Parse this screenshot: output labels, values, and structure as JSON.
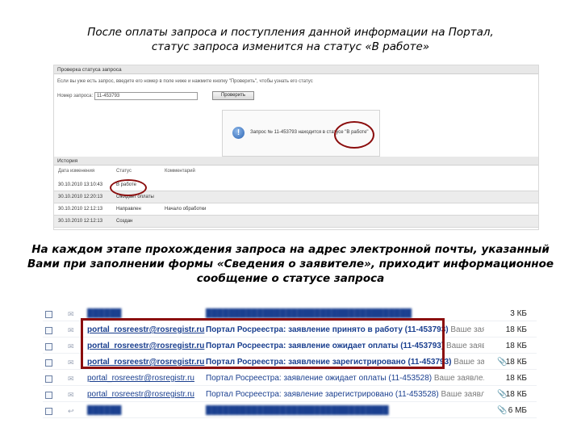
{
  "captions": {
    "top_line1": "После оплаты запроса и поступления данной информации на Портал,",
    "top_line2": "статус запроса изменится на статус «В работе»",
    "bottom_line1": "На каждом этапе прохождения запроса на адрес электронной почты, указанный",
    "bottom_line2": "Вами при заполнении формы «Сведения о заявителе», приходит информационное",
    "bottom_line3": "сообщение о статусе запроса"
  },
  "portal": {
    "panel_title": "Проверка статуса запроса",
    "hint": "Если вы уже есть запрос, введите его номер в поле ниже и нажмите кнопку \"Проверить\", чтобы узнать его статус",
    "request_number_label": "Номер запроса:",
    "request_number_value": "11-453793",
    "check_button": "Проверить",
    "status_message": "Запрос № 11-453793 находится в статусе \"В работе\"",
    "history_title": "История",
    "history_columns": [
      "Дата изменения",
      "Статус",
      "Комментарий"
    ],
    "history_rows": [
      {
        "date": "30.10.2010 13:10:43",
        "status": "В работе",
        "comment": ""
      },
      {
        "date": "30.10.2010 12:20:13",
        "status": "Ожидает оплаты",
        "comment": ""
      },
      {
        "date": "30.10.2010 12:12:13",
        "status": "Направлен",
        "comment": "Начало обработки"
      },
      {
        "date": "30.10.2010 12:12:13",
        "status": "Создан",
        "comment": ""
      }
    ]
  },
  "mail": {
    "rows": [
      {
        "sender": "",
        "subject": "",
        "snippet": "",
        "attachment": false,
        "size": "3 КБ"
      },
      {
        "sender": "portal_rosreestr@rosregistr.ru",
        "subject": "Портал Росреестра: заявление принято в работу (11-453793)",
        "snippet": "Ваше заявле...",
        "attachment": false,
        "size": "18 КБ"
      },
      {
        "sender": "portal_rosreestr@rosregistr.ru",
        "subject": "Портал Росреестра: заявление ожидает оплаты (11-453793)",
        "snippet": "Ваше заявле...",
        "attachment": false,
        "size": "18 КБ"
      },
      {
        "sender": "portal_rosreestr@rosregistr.ru",
        "subject": "Портал Росреестра: заявление зарегистрировано (11-453793)",
        "snippet": "Ваше заявле...",
        "attachment": true,
        "size": "18 КБ"
      },
      {
        "sender": "portal_rosreestr@rosregistr.ru",
        "subject": "Портал Росреестра: заявление ожидает оплаты (11-453528)",
        "snippet": "Ваше заявле...",
        "attachment": false,
        "size": "18 КБ"
      },
      {
        "sender": "portal_rosreestr@rosregistr.ru",
        "subject": "Портал Росреестра: заявление зарегистрировано (11-453528)",
        "snippet": "Ваше заявле...",
        "attachment": true,
        "size": "18 КБ"
      },
      {
        "sender": "",
        "subject": "",
        "snippet": "",
        "attachment": true,
        "size": "6 МБ"
      }
    ]
  },
  "colors": {
    "highlight": "#8b0d0d",
    "link": "#1a3f8f"
  }
}
